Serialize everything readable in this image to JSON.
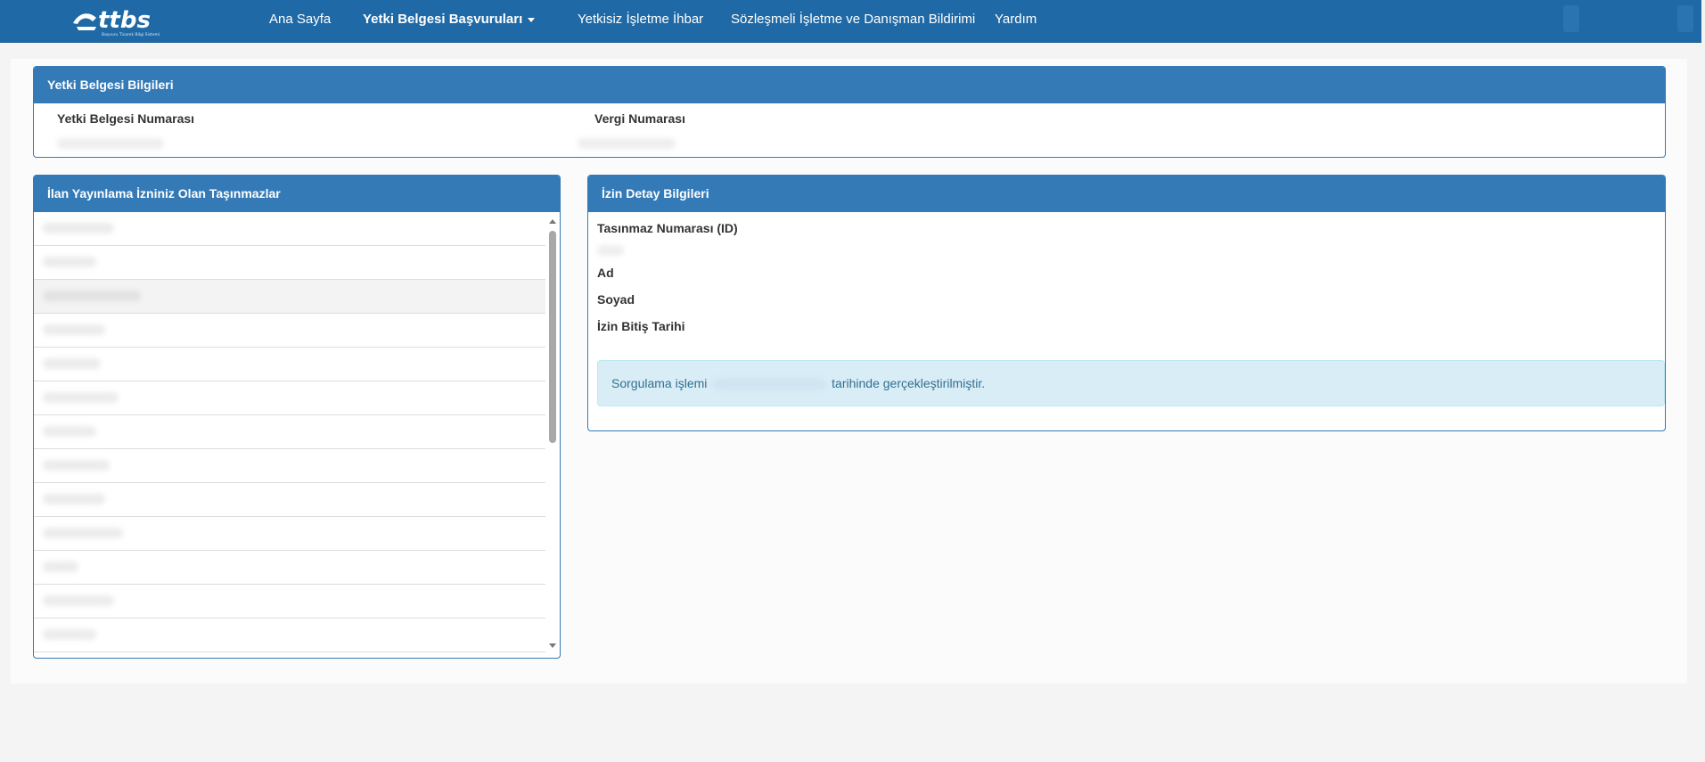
{
  "navbar": {
    "logo_text": "ttbs",
    "logo_subtitle": "Başvuru Ticarek Bilgi Sistemi",
    "items": [
      {
        "label": "Ana Sayfa"
      },
      {
        "label": "Yetki Belgesi Başvuruları"
      },
      {
        "label": "Yetkisiz İşletme İhbar"
      },
      {
        "label": "Sözleşmeli İşletme ve Danışman Bildirimi"
      },
      {
        "label": "Yardım"
      }
    ]
  },
  "certificate_panel": {
    "title": "Yetki Belgesi Bilgileri",
    "certificate_number_label": "Yetki Belgesi Numarası",
    "tax_number_label": "Vergi Numarası"
  },
  "properties_panel": {
    "title": "İlan Yayınlama İzniniz Olan Taşınmazlar"
  },
  "detail_panel": {
    "title": "İzin Detay Bilgileri",
    "property_id_label": "Tasınmaz Numarası (ID)",
    "name_label": "Ad",
    "surname_label": "Soyad",
    "expiry_label": "İzin Bitiş Tarihi",
    "alert_prefix": "Sorgulama işlemi",
    "alert_suffix": "tarihinde gerçekleştirilmiştir."
  },
  "colors": {
    "navbar": "#1f69a6",
    "panel_primary": "#337ab7",
    "alert_bg": "#d9edf7",
    "alert_text": "#31708f"
  }
}
